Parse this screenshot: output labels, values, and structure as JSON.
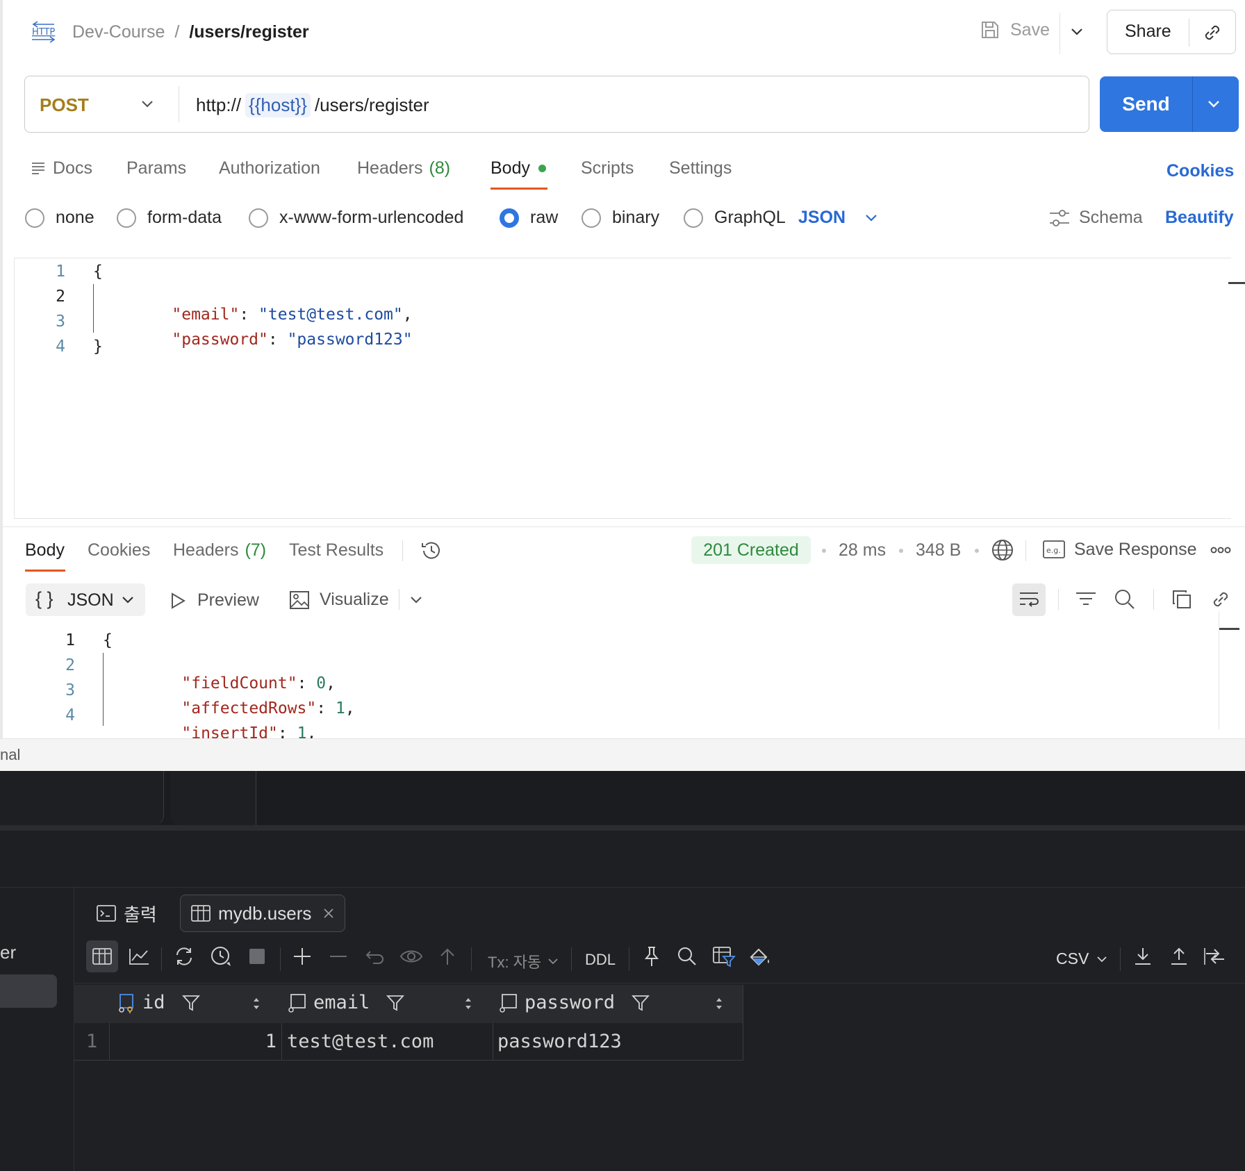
{
  "request": {
    "breadcrumb": {
      "icon": "http-icon",
      "collection": "Dev-Course",
      "separator": "/",
      "name": "/users/register"
    },
    "save_label": "Save",
    "share_label": "Share",
    "method": "POST",
    "url": {
      "prefix": "http://",
      "variable": "{{host}}",
      "path": "/users/register"
    },
    "send_label": "Send",
    "tabs": [
      {
        "label": "Docs"
      },
      {
        "label": "Params"
      },
      {
        "label": "Authorization"
      },
      {
        "label": "Headers",
        "count": "(8)"
      },
      {
        "label": "Body"
      },
      {
        "label": "Scripts"
      },
      {
        "label": "Settings"
      }
    ],
    "cookies_link": "Cookies",
    "body_types": [
      "none",
      "form-data",
      "x-www-form-urlencoded",
      "raw",
      "binary",
      "GraphQL"
    ],
    "selected_body_type": "raw",
    "body_format": "JSON",
    "schema_label": "Schema",
    "beautify_label": "Beautify",
    "body_lines": [
      {
        "n": "1",
        "text": "{"
      },
      {
        "n": "2",
        "key": "\"email\"",
        "value": "\"test@test.com\"",
        "trail": ","
      },
      {
        "n": "3",
        "key": "\"password\"",
        "value": "\"password123\"",
        "trail": ""
      },
      {
        "n": "4",
        "text": "}"
      }
    ]
  },
  "response": {
    "tabs": [
      {
        "label": "Body"
      },
      {
        "label": "Cookies"
      },
      {
        "label": "Headers",
        "count": "(7)"
      },
      {
        "label": "Test Results"
      }
    ],
    "status": "201 Created",
    "time": "28 ms",
    "size": "348 B",
    "save_response_label": "Save Response",
    "format": "JSON",
    "preview_label": "Preview",
    "visualize_label": "Visualize",
    "lines": [
      {
        "n": "1",
        "text": "{"
      },
      {
        "n": "2",
        "key": "\"fieldCount\"",
        "value": "0",
        "trail": ","
      },
      {
        "n": "3",
        "key": "\"affectedRows\"",
        "value": "1",
        "trail": ","
      },
      {
        "n": "4",
        "key": "\"insertId\"",
        "value": "1",
        "trail": ","
      }
    ]
  },
  "status_bar": {
    "text": "nal"
  },
  "ide": {
    "left_fragment": "er",
    "tabs": [
      {
        "label": "출력",
        "icon": "console-icon"
      },
      {
        "label": "mydb.users",
        "icon": "table-icon"
      }
    ],
    "toolbar": {
      "tx_label": "Tx: 자동",
      "ddl_label": "DDL",
      "export_format": "CSV"
    },
    "grid": {
      "columns": [
        "id",
        "email",
        "password"
      ],
      "rows": [
        {
          "row_num": "1",
          "id": "1",
          "email": "test@test.com",
          "password": "password123"
        }
      ]
    }
  }
}
